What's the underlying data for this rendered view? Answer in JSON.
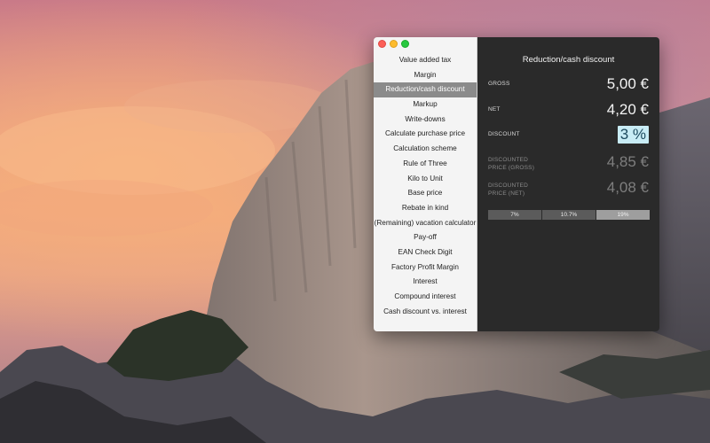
{
  "window": {
    "traffic_lights": [
      "close",
      "minimize",
      "maximize"
    ]
  },
  "sidebar": {
    "items": [
      {
        "label": "Value added tax",
        "active": false
      },
      {
        "label": "Margin",
        "active": false
      },
      {
        "label": "Reduction/cash discount",
        "active": true
      },
      {
        "label": "Markup",
        "active": false
      },
      {
        "label": "Write-downs",
        "active": false
      },
      {
        "label": "Calculate purchase price",
        "active": false
      },
      {
        "label": "Calculation scheme",
        "active": false
      },
      {
        "label": "Rule of Three",
        "active": false
      },
      {
        "label": "Kilo to Unit",
        "active": false
      },
      {
        "label": "Base price",
        "active": false
      },
      {
        "label": "Rebate in kind",
        "active": false
      },
      {
        "label": "(Remaining) vacation calculator",
        "active": false
      },
      {
        "label": "Pay-off",
        "active": false
      },
      {
        "label": "EAN Check Digit",
        "active": false
      },
      {
        "label": "Factory Profit Margin",
        "active": false
      },
      {
        "label": "Interest",
        "active": false
      },
      {
        "label": "Compound interest",
        "active": false
      },
      {
        "label": "Cash discount vs. interest",
        "active": false
      }
    ]
  },
  "main": {
    "title": "Reduction/cash discount",
    "fields": {
      "gross": {
        "label": "GROSS",
        "value": "5,00 €"
      },
      "net": {
        "label": "NET",
        "value": "4,20 €"
      },
      "discount": {
        "label": "DISCOUNT",
        "value": "3 %"
      },
      "discounted_gross": {
        "label_line1": "DISCOUNTED",
        "label_line2": "PRICE (GROSS)",
        "value": "4,85 €"
      },
      "discounted_net": {
        "label_line1": "DISCOUNTED",
        "label_line2": "PRICE (NET)",
        "value": "4,08 €"
      }
    },
    "percent_presets": [
      "7%",
      "10.7%",
      "19%"
    ]
  },
  "colors": {
    "sidebar_bg": "#f4f4f4",
    "sidebar_active": "#8b8b8b",
    "panel_bg": "#2a2a2a",
    "input_highlight": "#c8ecf5"
  }
}
